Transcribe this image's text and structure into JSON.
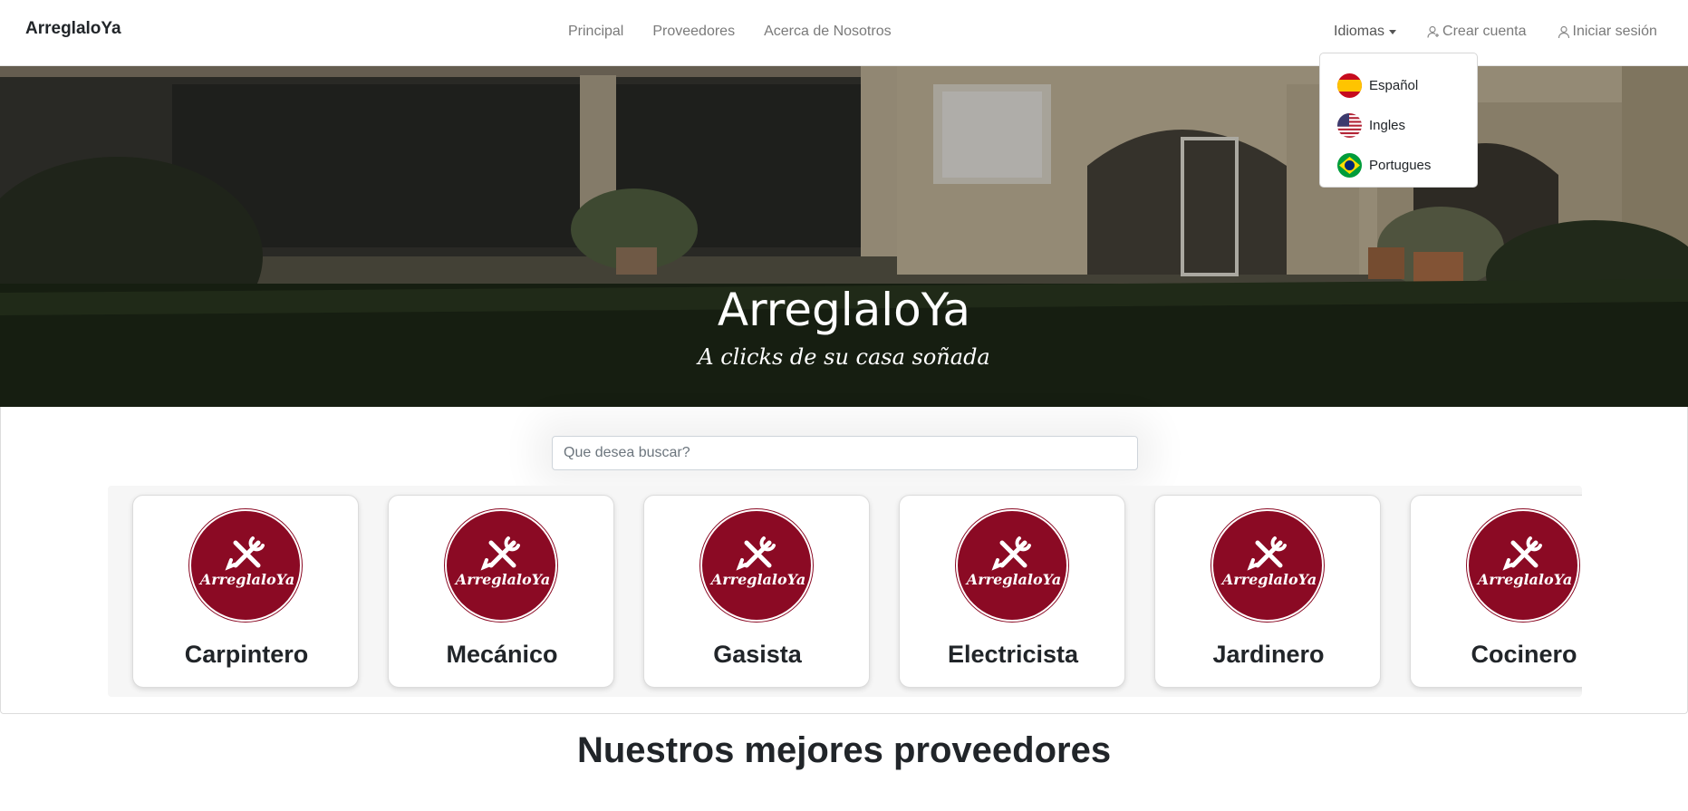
{
  "brand": "ArreglaloYa",
  "nav": {
    "items": [
      {
        "label": "Principal"
      },
      {
        "label": "Proveedores"
      },
      {
        "label": "Acerca de Nosotros"
      }
    ],
    "languages_label": "Idiomas",
    "create_account": "Crear cuenta",
    "login": "Iniciar sesión"
  },
  "language_menu": {
    "items": [
      {
        "label": "Español",
        "flag": "spain-flag-icon"
      },
      {
        "label": "Ingles",
        "flag": "usa-flag-icon"
      },
      {
        "label": "Portugues",
        "flag": "brazil-flag-icon"
      }
    ]
  },
  "hero": {
    "title": "ArreglaloYa",
    "subtitle": "A clicks de su casa soñada"
  },
  "search": {
    "placeholder": "Que desea buscar?"
  },
  "categories": [
    {
      "name": "Carpintero"
    },
    {
      "name": "Mecánico"
    },
    {
      "name": "Gasista"
    },
    {
      "name": "Electricista"
    },
    {
      "name": "Jardinero"
    },
    {
      "name": "Cocinero"
    }
  ],
  "logo_text": "ArreglaloYa",
  "best_providers_title": "Nuestros mejores proveedores",
  "colors": {
    "brand_red": "#8b0a24",
    "nav_text": "#7a7a7a"
  }
}
